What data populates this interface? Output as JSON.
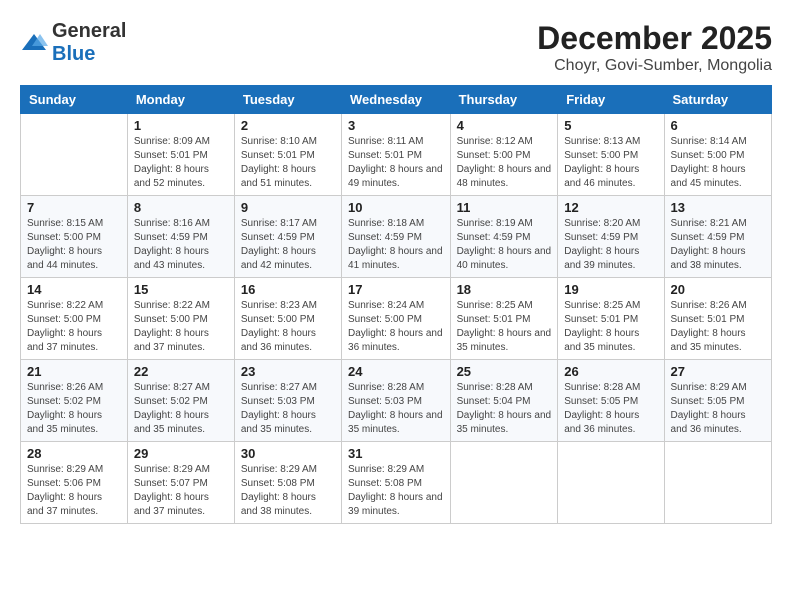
{
  "header": {
    "logo_general": "General",
    "logo_blue": "Blue",
    "title": "December 2025",
    "subtitle": "Choyr, Govi-Sumber, Mongolia"
  },
  "days_of_week": [
    "Sunday",
    "Monday",
    "Tuesday",
    "Wednesday",
    "Thursday",
    "Friday",
    "Saturday"
  ],
  "weeks": [
    [
      {
        "day": "",
        "sunrise": "",
        "sunset": "",
        "daylight": ""
      },
      {
        "day": "1",
        "sunrise": "Sunrise: 8:09 AM",
        "sunset": "Sunset: 5:01 PM",
        "daylight": "Daylight: 8 hours and 52 minutes."
      },
      {
        "day": "2",
        "sunrise": "Sunrise: 8:10 AM",
        "sunset": "Sunset: 5:01 PM",
        "daylight": "Daylight: 8 hours and 51 minutes."
      },
      {
        "day": "3",
        "sunrise": "Sunrise: 8:11 AM",
        "sunset": "Sunset: 5:01 PM",
        "daylight": "Daylight: 8 hours and 49 minutes."
      },
      {
        "day": "4",
        "sunrise": "Sunrise: 8:12 AM",
        "sunset": "Sunset: 5:00 PM",
        "daylight": "Daylight: 8 hours and 48 minutes."
      },
      {
        "day": "5",
        "sunrise": "Sunrise: 8:13 AM",
        "sunset": "Sunset: 5:00 PM",
        "daylight": "Daylight: 8 hours and 46 minutes."
      },
      {
        "day": "6",
        "sunrise": "Sunrise: 8:14 AM",
        "sunset": "Sunset: 5:00 PM",
        "daylight": "Daylight: 8 hours and 45 minutes."
      }
    ],
    [
      {
        "day": "7",
        "sunrise": "Sunrise: 8:15 AM",
        "sunset": "Sunset: 5:00 PM",
        "daylight": "Daylight: 8 hours and 44 minutes."
      },
      {
        "day": "8",
        "sunrise": "Sunrise: 8:16 AM",
        "sunset": "Sunset: 4:59 PM",
        "daylight": "Daylight: 8 hours and 43 minutes."
      },
      {
        "day": "9",
        "sunrise": "Sunrise: 8:17 AM",
        "sunset": "Sunset: 4:59 PM",
        "daylight": "Daylight: 8 hours and 42 minutes."
      },
      {
        "day": "10",
        "sunrise": "Sunrise: 8:18 AM",
        "sunset": "Sunset: 4:59 PM",
        "daylight": "Daylight: 8 hours and 41 minutes."
      },
      {
        "day": "11",
        "sunrise": "Sunrise: 8:19 AM",
        "sunset": "Sunset: 4:59 PM",
        "daylight": "Daylight: 8 hours and 40 minutes."
      },
      {
        "day": "12",
        "sunrise": "Sunrise: 8:20 AM",
        "sunset": "Sunset: 4:59 PM",
        "daylight": "Daylight: 8 hours and 39 minutes."
      },
      {
        "day": "13",
        "sunrise": "Sunrise: 8:21 AM",
        "sunset": "Sunset: 4:59 PM",
        "daylight": "Daylight: 8 hours and 38 minutes."
      }
    ],
    [
      {
        "day": "14",
        "sunrise": "Sunrise: 8:22 AM",
        "sunset": "Sunset: 5:00 PM",
        "daylight": "Daylight: 8 hours and 37 minutes."
      },
      {
        "day": "15",
        "sunrise": "Sunrise: 8:22 AM",
        "sunset": "Sunset: 5:00 PM",
        "daylight": "Daylight: 8 hours and 37 minutes."
      },
      {
        "day": "16",
        "sunrise": "Sunrise: 8:23 AM",
        "sunset": "Sunset: 5:00 PM",
        "daylight": "Daylight: 8 hours and 36 minutes."
      },
      {
        "day": "17",
        "sunrise": "Sunrise: 8:24 AM",
        "sunset": "Sunset: 5:00 PM",
        "daylight": "Daylight: 8 hours and 36 minutes."
      },
      {
        "day": "18",
        "sunrise": "Sunrise: 8:25 AM",
        "sunset": "Sunset: 5:01 PM",
        "daylight": "Daylight: 8 hours and 35 minutes."
      },
      {
        "day": "19",
        "sunrise": "Sunrise: 8:25 AM",
        "sunset": "Sunset: 5:01 PM",
        "daylight": "Daylight: 8 hours and 35 minutes."
      },
      {
        "day": "20",
        "sunrise": "Sunrise: 8:26 AM",
        "sunset": "Sunset: 5:01 PM",
        "daylight": "Daylight: 8 hours and 35 minutes."
      }
    ],
    [
      {
        "day": "21",
        "sunrise": "Sunrise: 8:26 AM",
        "sunset": "Sunset: 5:02 PM",
        "daylight": "Daylight: 8 hours and 35 minutes."
      },
      {
        "day": "22",
        "sunrise": "Sunrise: 8:27 AM",
        "sunset": "Sunset: 5:02 PM",
        "daylight": "Daylight: 8 hours and 35 minutes."
      },
      {
        "day": "23",
        "sunrise": "Sunrise: 8:27 AM",
        "sunset": "Sunset: 5:03 PM",
        "daylight": "Daylight: 8 hours and 35 minutes."
      },
      {
        "day": "24",
        "sunrise": "Sunrise: 8:28 AM",
        "sunset": "Sunset: 5:03 PM",
        "daylight": "Daylight: 8 hours and 35 minutes."
      },
      {
        "day": "25",
        "sunrise": "Sunrise: 8:28 AM",
        "sunset": "Sunset: 5:04 PM",
        "daylight": "Daylight: 8 hours and 35 minutes."
      },
      {
        "day": "26",
        "sunrise": "Sunrise: 8:28 AM",
        "sunset": "Sunset: 5:05 PM",
        "daylight": "Daylight: 8 hours and 36 minutes."
      },
      {
        "day": "27",
        "sunrise": "Sunrise: 8:29 AM",
        "sunset": "Sunset: 5:05 PM",
        "daylight": "Daylight: 8 hours and 36 minutes."
      }
    ],
    [
      {
        "day": "28",
        "sunrise": "Sunrise: 8:29 AM",
        "sunset": "Sunset: 5:06 PM",
        "daylight": "Daylight: 8 hours and 37 minutes."
      },
      {
        "day": "29",
        "sunrise": "Sunrise: 8:29 AM",
        "sunset": "Sunset: 5:07 PM",
        "daylight": "Daylight: 8 hours and 37 minutes."
      },
      {
        "day": "30",
        "sunrise": "Sunrise: 8:29 AM",
        "sunset": "Sunset: 5:08 PM",
        "daylight": "Daylight: 8 hours and 38 minutes."
      },
      {
        "day": "31",
        "sunrise": "Sunrise: 8:29 AM",
        "sunset": "Sunset: 5:08 PM",
        "daylight": "Daylight: 8 hours and 39 minutes."
      },
      {
        "day": "",
        "sunrise": "",
        "sunset": "",
        "daylight": ""
      },
      {
        "day": "",
        "sunrise": "",
        "sunset": "",
        "daylight": ""
      },
      {
        "day": "",
        "sunrise": "",
        "sunset": "",
        "daylight": ""
      }
    ]
  ]
}
